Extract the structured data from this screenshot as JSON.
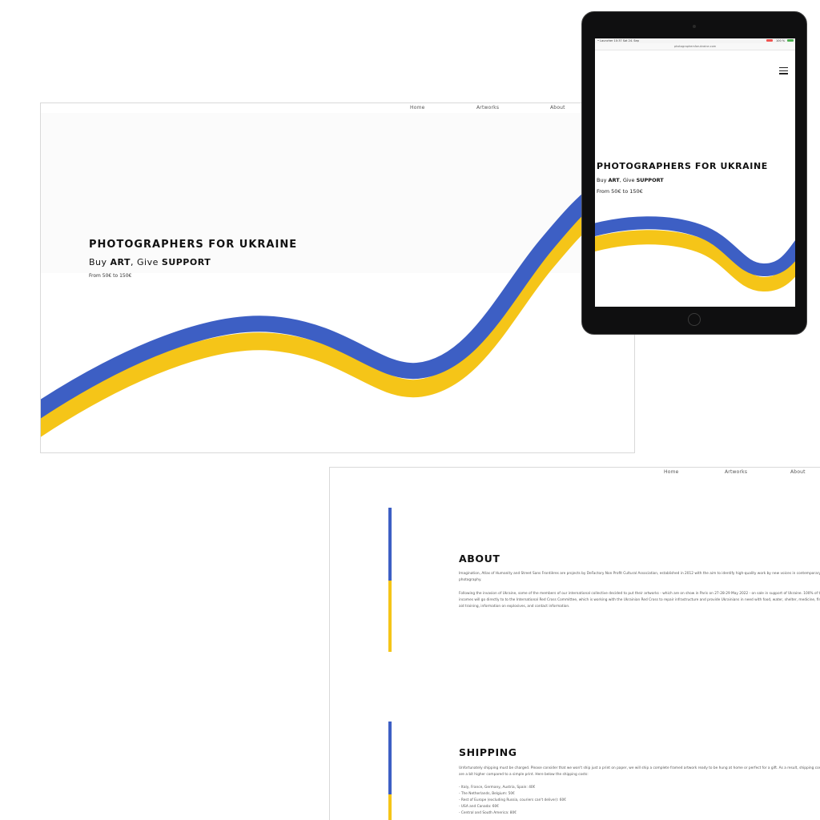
{
  "nav": {
    "home": "Home",
    "artworks": "Artworks",
    "about": "About"
  },
  "hero": {
    "title": "PHOTOGRAPHERS FOR UKRAINE",
    "tagline": {
      "buy": "Buy ",
      "art": "ART",
      "give": ", Give ",
      "support": "SUPPORT"
    },
    "price": "From 50€ to 150€"
  },
  "tablet": {
    "status": {
      "left": "• Launcher  10:37  Sat 24. Sep",
      "right": "100 %"
    },
    "url": "photographersforukraine.com",
    "icons": {
      "menu": "hamburger-menu-icon"
    }
  },
  "colors": {
    "blue": "#3d5fc4",
    "yellow": "#f5c518",
    "battery": "#ef5350",
    "battery_ok": "#4caf50"
  },
  "about": {
    "title": "ABOUT",
    "p1": "Imagination, Atlas of Humanity and Street Sans Frontières are projects by DeFactory Non Profit Cultural Association, established in 2012 with the aim to identify high-quality work by new voices in contemporary photography.",
    "p2": "Following the invasion of Ukraine, some of the members of our international collective decided to put their artworks - which are on show in Paris on 27-28-29 May 2022 - on sale in support of Ukraine. 100% of the incomes will go directly to to the International Red Cross Committee, which is working with the Ukrainian Red Cross to repair infrastructure and provide Ukrainians in need with food, water, shelter, medicine, first aid training, information on explosives, and contact information."
  },
  "shipping": {
    "title": "SHIPPING",
    "intro": "Unfortunately shipping must be charged. Please consider that we won't ship just a print on paper, we will ship a complete framed artwork ready to be hung at home or perfect for a gift. As a result, shipping costs are a bit higher compared to a simple print. Here below the shipping costs:",
    "items": [
      "- Italy, France, Germany, Austria, Spain: 40€",
      "- The Netherlands, Belgium: 50€",
      "- Rest of Europe (excluding Russia, couriers can't deliver): 60€",
      "- USA and Canada: 60€",
      "- Central and South America: 80€"
    ]
  }
}
